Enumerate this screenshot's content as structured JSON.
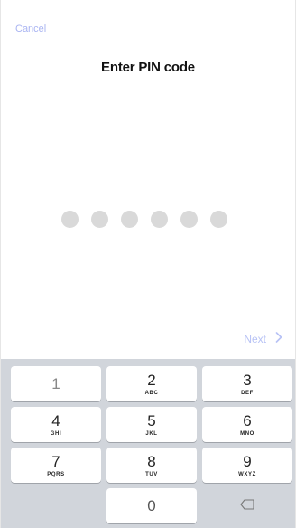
{
  "header": {
    "cancel_label": "Cancel",
    "title": "Enter PIN code"
  },
  "pin": {
    "length": 6,
    "filled": 0
  },
  "footer": {
    "next_label": "Next",
    "next_icon": "chevron-right-icon"
  },
  "keypad": {
    "k1": {
      "num": "1",
      "letters": ""
    },
    "k2": {
      "num": "2",
      "letters": "ABC"
    },
    "k3": {
      "num": "3",
      "letters": "DEF"
    },
    "k4": {
      "num": "4",
      "letters": "GHI"
    },
    "k5": {
      "num": "5",
      "letters": "JKL"
    },
    "k6": {
      "num": "6",
      "letters": "MNO"
    },
    "k7": {
      "num": "7",
      "letters": "PQRS"
    },
    "k8": {
      "num": "8",
      "letters": "TUV"
    },
    "k9": {
      "num": "9",
      "letters": "WXYZ"
    },
    "k0": {
      "num": "0"
    },
    "backspace_icon": "backspace-icon"
  },
  "colors": {
    "accent": "#a9b4f2",
    "dot": "#d9d9d9",
    "keypad_bg": "#d1d5db",
    "key_bg": "#ffffff"
  }
}
